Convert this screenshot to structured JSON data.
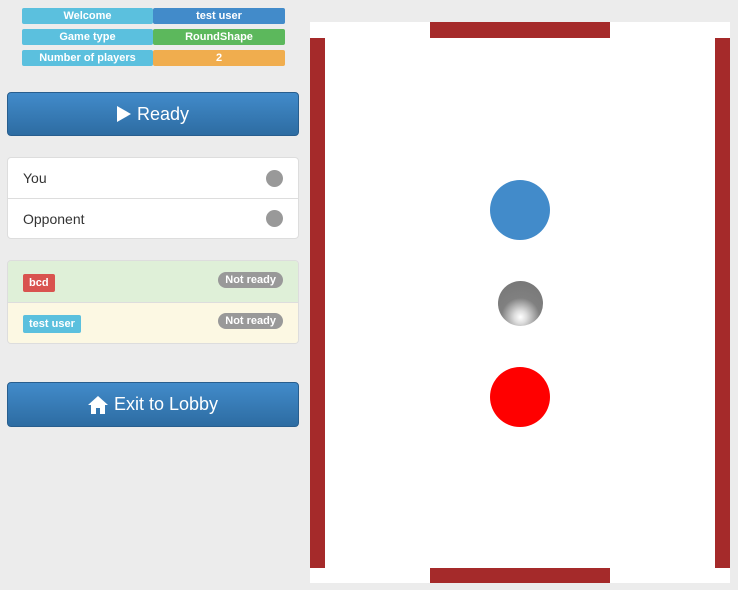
{
  "info": {
    "welcome_label": "Welcome",
    "welcome_value": "test user",
    "game_type_label": "Game type",
    "game_type_value": "RoundShape",
    "players_label": "Number of players",
    "players_value": "2"
  },
  "ready_button": {
    "label": "Ready",
    "icon": "play-icon"
  },
  "players": [
    {
      "label": "You"
    },
    {
      "label": "Opponent"
    }
  ],
  "status": [
    {
      "name": "bcd",
      "status": "Not ready"
    },
    {
      "name": "test user",
      "status": "Not ready"
    }
  ],
  "exit_button": {
    "label": "Exit to Lobby",
    "icon": "home-icon"
  },
  "colors": {
    "wall": "#a52a2a",
    "opponent_paddle": "#428bca",
    "puck": "#808080",
    "player_paddle": "#ff0000"
  }
}
